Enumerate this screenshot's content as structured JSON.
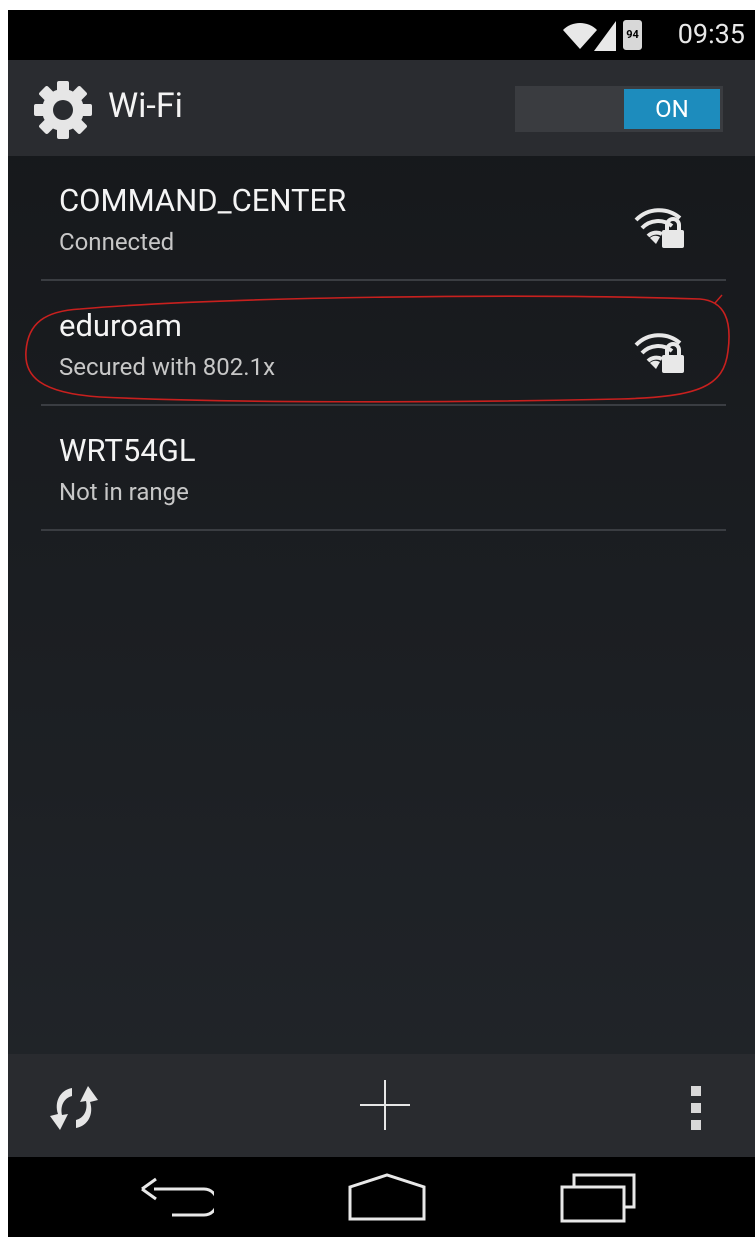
{
  "status_bar": {
    "time": "09:35",
    "battery_percent": "94",
    "icons": [
      "wifi-icon",
      "signal-icon",
      "battery-icon"
    ]
  },
  "action_bar": {
    "icon": "gear-icon",
    "title": "Wi-Fi",
    "toggle_label": "ON",
    "toggle_color": "#1d8cbd"
  },
  "networks": [
    {
      "name": "COMMAND_CENTER",
      "status": "Connected",
      "icon": "wifi-lock-icon"
    },
    {
      "name": "eduroam",
      "status": "Secured with 802.1x",
      "icon": "wifi-lock-icon"
    },
    {
      "name": "WRT54GL",
      "status": "Not in range",
      "icon": ""
    }
  ],
  "annotation_color": "#c8201e",
  "bottom_bar": {
    "icons": [
      "refresh-icon",
      "add-icon",
      "overflow-menu-icon"
    ]
  },
  "nav_bar": {
    "icons": [
      "back-icon",
      "home-icon",
      "recents-icon"
    ]
  }
}
